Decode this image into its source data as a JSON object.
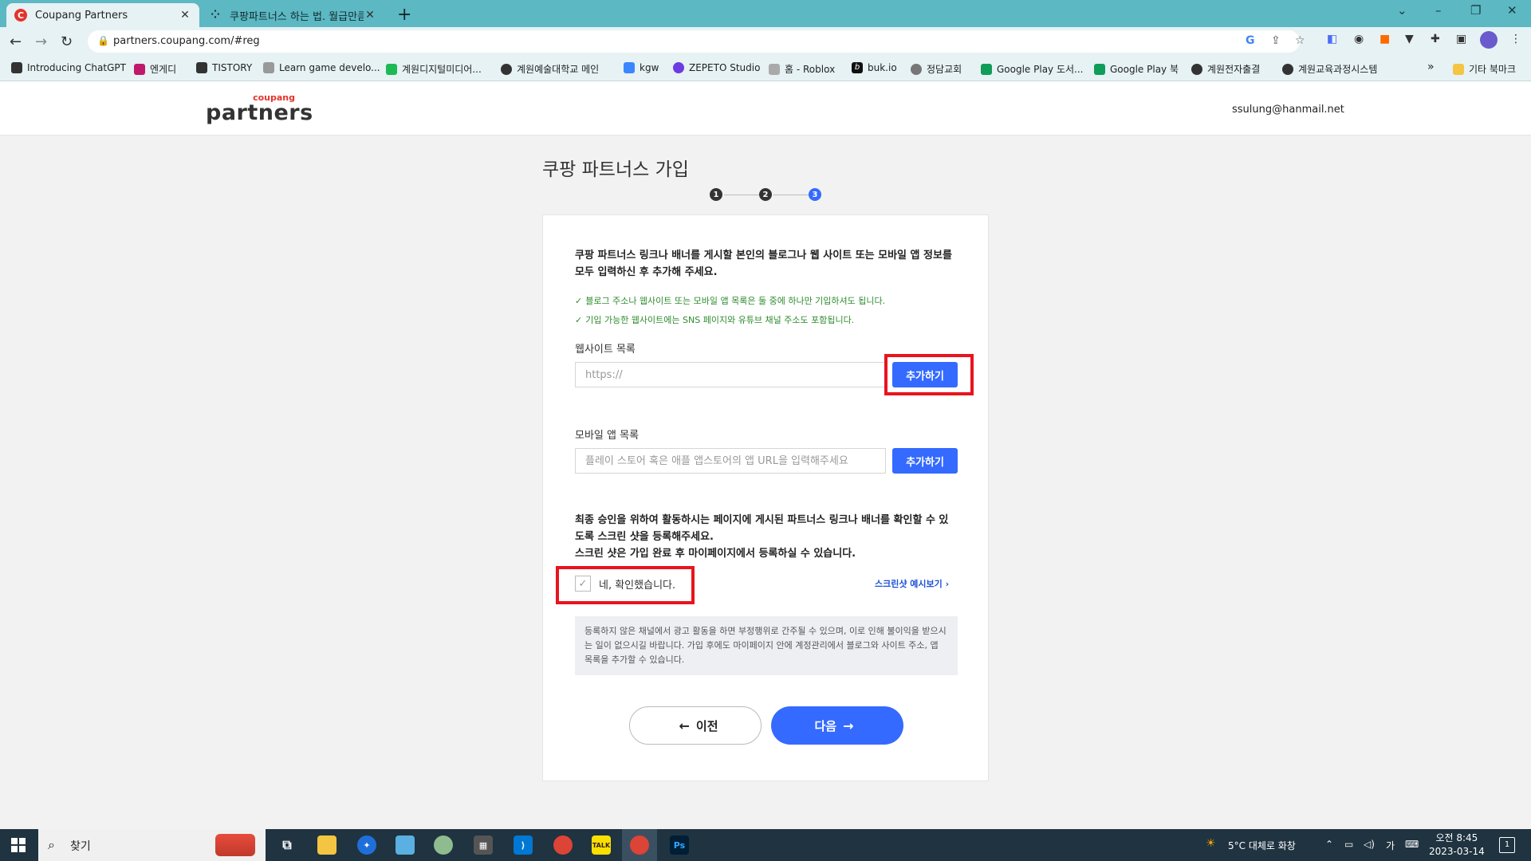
{
  "browser": {
    "tabs": [
      {
        "title": "Coupang Partners",
        "active": true
      },
      {
        "title": "쿠팡파트너스 하는 법. 월급만큼",
        "active": false
      }
    ],
    "url": "partners.coupang.com/#reg",
    "bookmarks": [
      "Introducing ChatGPT",
      "엔게디",
      "TISTORY",
      "Learn game develo...",
      "계원디지털미디어...",
      "계원예술대학교 메인",
      "kgw",
      "ZEPETO Studio",
      "홈 - Roblox",
      "buk.io",
      "정담교회",
      "Google Play 도서...",
      "Google Play 북",
      "계원전자출결",
      "계원교육과정시스템"
    ],
    "bookmarks_overflow": "»",
    "other_bookmarks": "기타 북마크"
  },
  "header": {
    "logo_small": "coupang",
    "logo_big": "partners",
    "user_email": "ssulung@hanmail.net"
  },
  "page": {
    "title": "쿠팡 파트너스 가입",
    "steps": [
      "1",
      "2",
      "3"
    ],
    "current_step": 3
  },
  "form": {
    "intro": "쿠팡 파트너스 링크나 배너를 게시할 본인의 블로그나 웹 사이트 또는 모바일 앱 정보를 모두 입력하신 후 추가해 주세요.",
    "notes": [
      "블로그 주소나 웹사이트 또는 모바일 앱 목록은 둘 중에 하나만 기입하셔도 됩니다.",
      "기입 가능한 웹사이트에는 SNS 페이지와 유튜브 채널 주소도 포함됩니다."
    ],
    "website": {
      "label": "웹사이트 목록",
      "placeholder": "https://",
      "button": "추가하기"
    },
    "mobile_app": {
      "label": "모바일 앱 목록",
      "placeholder": "플레이 스토어 혹은 애플 앱스토어의 앱 URL을 입력해주세요",
      "button": "추가하기"
    },
    "verify_text": "최종 승인을 위하여 활동하시는 페이지에 게시된 파트너스 링크나 배너를 확인할 수 있도록 스크린 샷을 등록해주세요.\n스크린 샷은 가입 완료 후 마이페이지에서 등록하실 수 있습니다.",
    "confirm_label": "네, 확인했습니다.",
    "screenshot_link": "스크린샷 예시보기",
    "notice": "등록하지 않은 채널에서 광고 활동을 하면 부정행위로 간주될 수 있으며, 이로 인해 불이익을 받으시는 일이 없으시길 바랍니다. 가입 후에도 마이페이지 안에 계정관리에서 블로그와 사이트 주소, 앱 목록을 추가할 수 있습니다.",
    "prev_button": "이전",
    "next_button": "다음"
  },
  "taskbar": {
    "search_placeholder": "찾기",
    "weather": "5°C  대체로 화창",
    "ime": "가",
    "time": "오전 8:45",
    "date": "2023-03-14",
    "notification_count": "1"
  },
  "colors": {
    "accent": "#346aff",
    "highlight": "#e8141e",
    "tabstrip": "#5cb8c2",
    "note_green": "#2e8b2e"
  }
}
